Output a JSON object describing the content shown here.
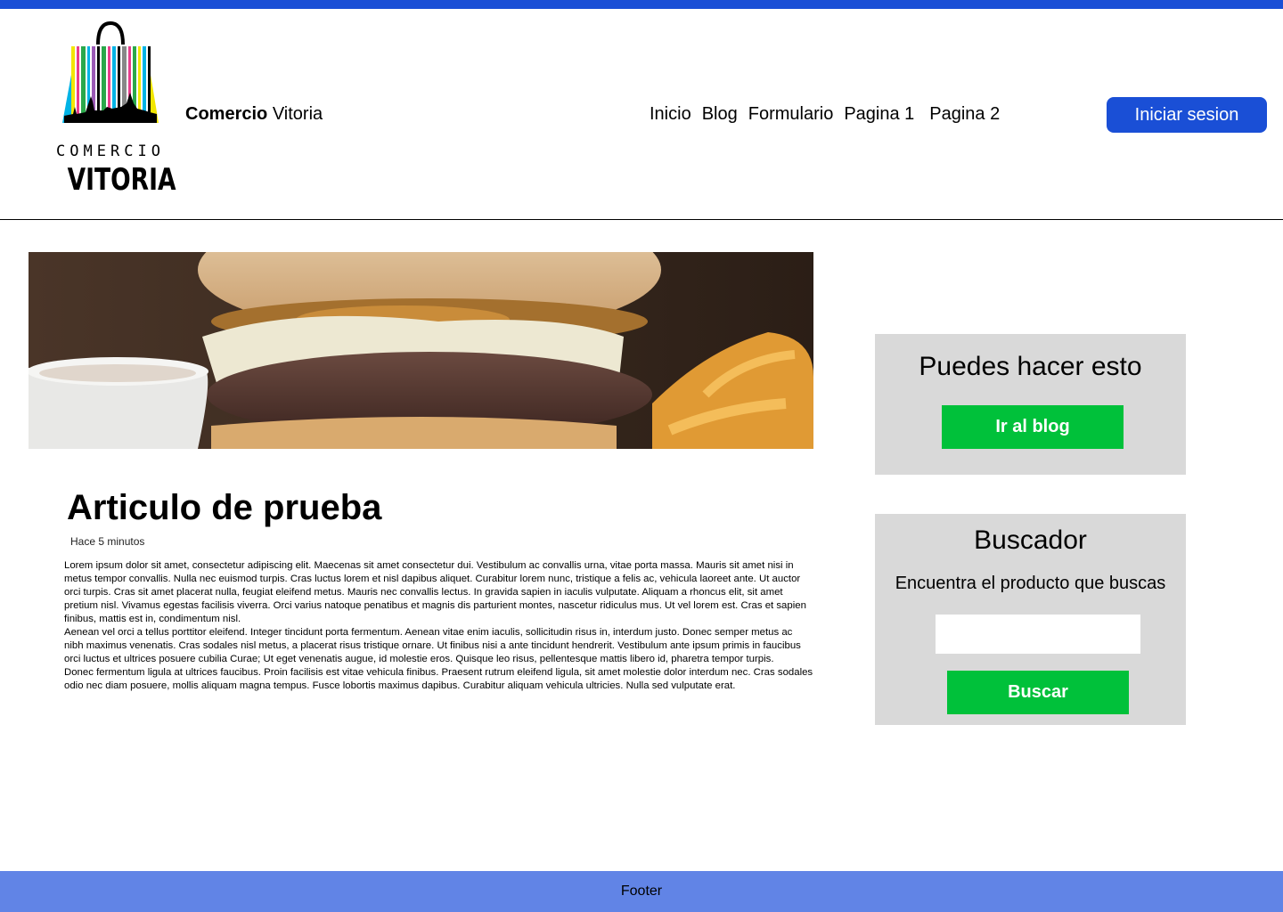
{
  "header": {
    "logo": {
      "line1": "COMERCIO",
      "line2": "VITORIA"
    },
    "brand": {
      "bold": "Comercio",
      "regular": "Vitoria"
    },
    "nav": [
      "Inicio",
      "Blog",
      "Formulario",
      "Pagina 1",
      "Pagina 2"
    ],
    "login_label": "Iniciar sesion",
    "accent_color": "#1a4fd6"
  },
  "article": {
    "hero_image": "burger-photo",
    "title": "Articulo de prueba",
    "time": "Hace 5 minutos",
    "paragraphs": [
      "Lorem ipsum dolor sit amet, consectetur adipiscing elit. Maecenas sit amet consectetur dui. Vestibulum ac convallis urna, vitae porta massa. Mauris sit amet nisi in metus tempor convallis. Nulla nec euismod turpis. Cras luctus lorem et nisl dapibus aliquet. Curabitur lorem nunc, tristique a felis ac, vehicula laoreet ante. Ut auctor orci turpis. Cras sit amet placerat nulla, feugiat eleifend metus. Mauris nec convallis lectus. In gravida sapien in iaculis vulputate. Aliquam a rhoncus elit, sit amet pretium nisl. Vivamus egestas facilisis viverra. Orci varius natoque penatibus et magnis dis parturient montes, nascetur ridiculus mus. Ut vel lorem est. Cras et sapien finibus, mattis est in, condimentum nisl.",
      "Aenean vel orci a tellus porttitor eleifend. Integer tincidunt porta fermentum. Aenean vitae enim iaculis, sollicitudin risus in, interdum justo. Donec semper metus ac nibh maximus venenatis. Cras sodales nisl metus, a placerat risus tristique ornare. Ut finibus nisi a ante tincidunt hendrerit. Vestibulum ante ipsum primis in faucibus orci luctus et ultrices posuere cubilia Curae; Ut eget venenatis augue, id molestie eros. Quisque leo risus, pellentesque mattis libero id, pharetra tempor turpis.",
      "Donec fermentum ligula at ultrices faucibus. Proin facilisis est vitae vehicula finibus. Praesent rutrum eleifend ligula, sit amet molestie dolor interdum nec. Cras sodales odio nec diam posuere, mollis aliquam magna tempus. Fusce lobortis maximus dapibus. Curabitur aliquam vehicula ultricies. Nulla sed vulputate erat."
    ]
  },
  "sidebar": {
    "card1": {
      "title": "Puedes hacer esto",
      "button": "Ir al blog"
    },
    "card2": {
      "title": "Buscador",
      "subtitle": "Encuentra el producto que buscas",
      "input_value": "",
      "button": "Buscar"
    },
    "card_bg": "#d9d9d9",
    "button_color": "#00c13a"
  },
  "footer": {
    "text": "Footer",
    "color": "#6184e6"
  }
}
